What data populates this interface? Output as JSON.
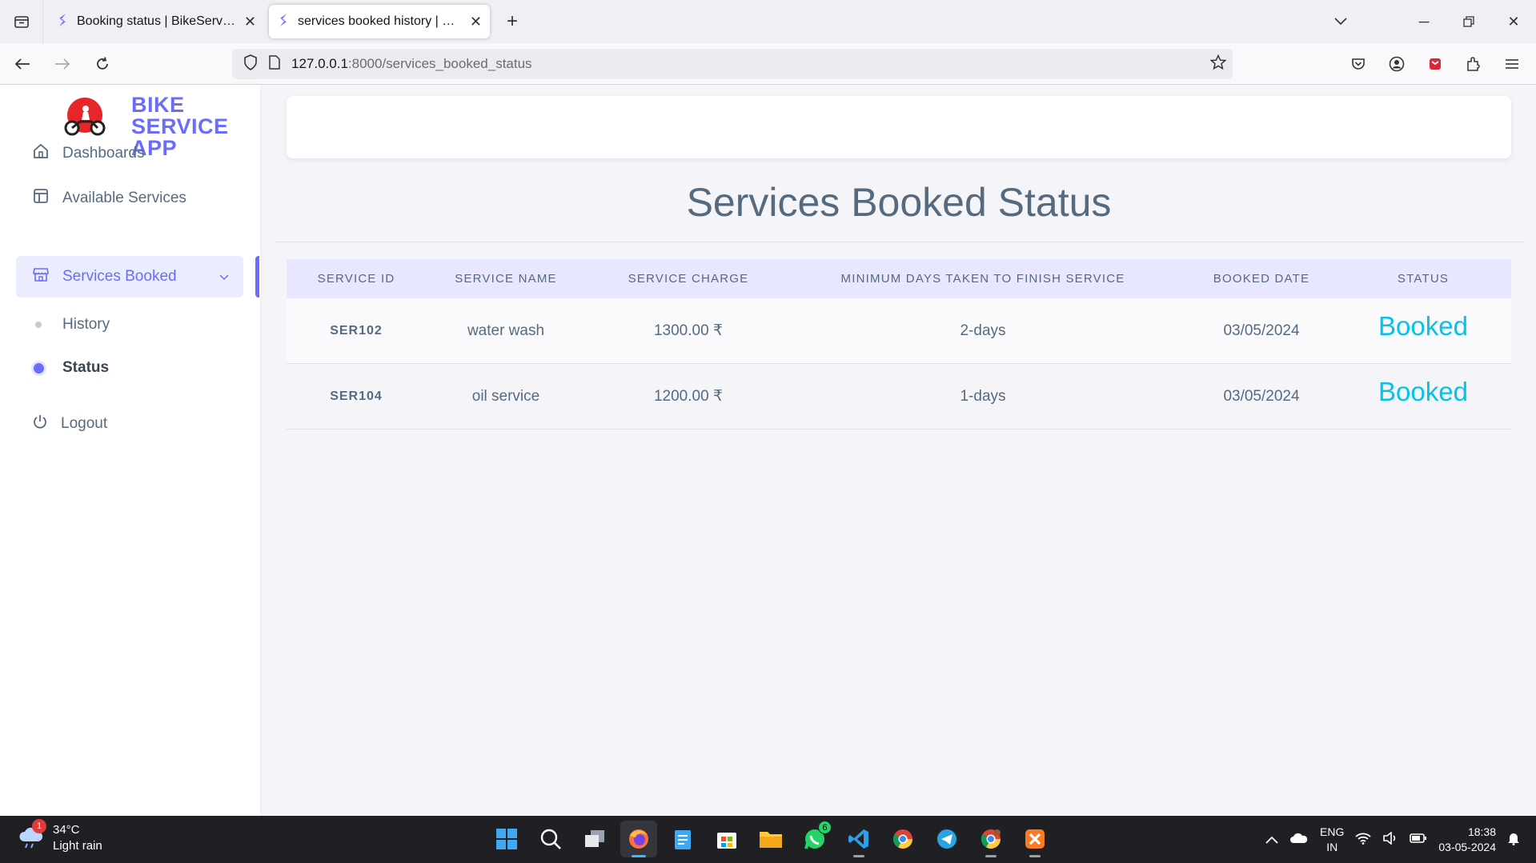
{
  "browser": {
    "tabs": [
      {
        "title": "Booking status | BikeServiceApp",
        "active": false
      },
      {
        "title": "services booked history | BikeServiceApp",
        "active": true
      }
    ],
    "url_host": "127.0.0.1",
    "url_path": ":8000/services_booked_status"
  },
  "sidebar": {
    "brand_line1": "BIKE",
    "brand_line2": "SERVICE",
    "brand_line3": "APP",
    "items": [
      {
        "label": "Dashboards"
      },
      {
        "label": "Available Services"
      },
      {
        "label": "Services Booked"
      },
      {
        "label": "History"
      },
      {
        "label": "Status"
      },
      {
        "label": "Logout"
      }
    ]
  },
  "main": {
    "title": "Services Booked Status",
    "columns": [
      "SERVICE ID",
      "SERVICE NAME",
      "SERVICE CHARGE",
      "MINIMUM DAYS TAKEN TO FINISH SERVICE",
      "BOOKED DATE",
      "STATUS"
    ],
    "rows": [
      {
        "id": "SER102",
        "name": "water wash",
        "charge": "1300.00 ₹",
        "days": "2-days",
        "date": "03/05/2024",
        "status": "Booked"
      },
      {
        "id": "SER104",
        "name": "oil service",
        "charge": "1200.00 ₹",
        "days": "1-days",
        "date": "03/05/2024",
        "status": "Booked"
      }
    ]
  },
  "taskbar": {
    "weather_temp": "34°C",
    "weather_desc": "Light rain",
    "weather_badge": "1",
    "whatsapp_badge": "6",
    "lang1": "ENG",
    "lang2": "IN",
    "time": "18:38",
    "date": "03-05-2024"
  },
  "colors": {
    "accent": "#696cff",
    "status": "#03c3ec",
    "table_header": "#e7e7ff"
  }
}
